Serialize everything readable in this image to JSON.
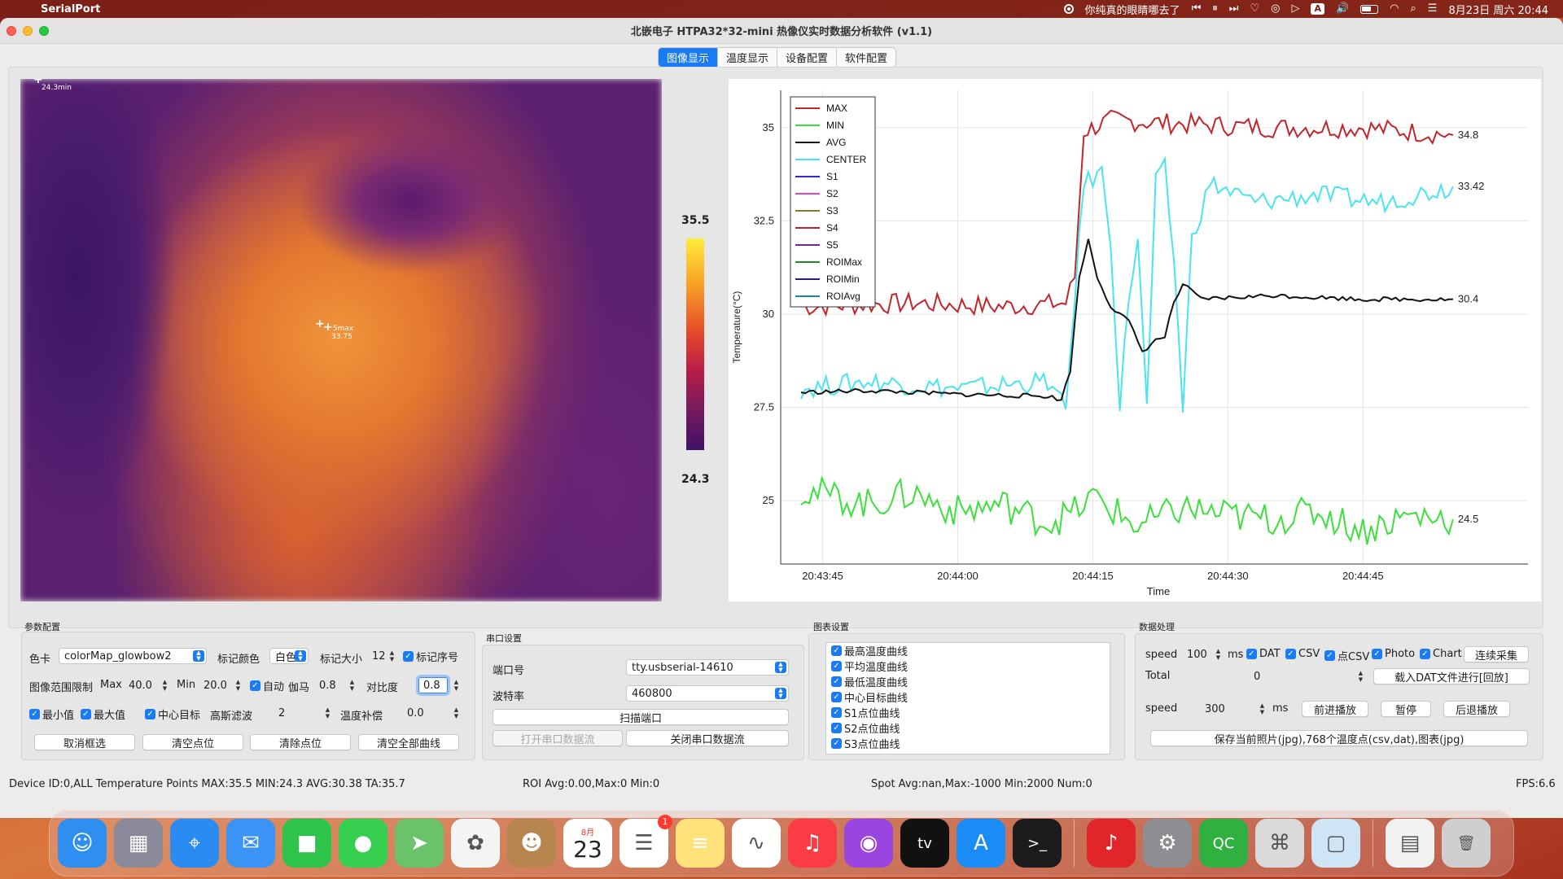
{
  "menubar": {
    "app_name": "SerialPort",
    "now_playing": "你纯真的眼睛哪去了",
    "input_source": "A",
    "datetime": "8月23日 周六  20:44"
  },
  "window": {
    "title": "北嵌电子 HTPA32*32-mini 热像仪实时数据分析软件 (v1.1)"
  },
  "tabs": [
    "图像显示",
    "温度显示",
    "设备配置",
    "软件配置"
  ],
  "active_tab": 0,
  "heatmap": {
    "min_marker": "24.3min",
    "max_marker_label": "5max",
    "max_marker_value": "33.75",
    "colorbar_max": "35.5",
    "colorbar_min": "24.3"
  },
  "chart_data": {
    "type": "line",
    "xlabel": "Time",
    "ylabel": "Temperature(°C)",
    "x_ticks": [
      "20:43:45",
      "20:44:00",
      "20:44:15",
      "20:44:30",
      "20:44:45"
    ],
    "y_ticks": [
      "25",
      "27.5",
      "30",
      "32.5",
      "35"
    ],
    "ylim": [
      23.3,
      36.0
    ],
    "x_range_seconds_from_first_tick": [
      -2.4,
      72
    ],
    "grid": true,
    "legend_position": "top-left",
    "legend": [
      "MAX",
      "MIN",
      "AVG",
      "CENTER",
      "S1",
      "S2",
      "S3",
      "S4",
      "S5",
      "ROIMax",
      "ROIMin",
      "ROIAvg"
    ],
    "legend_colors": [
      "#c0262b",
      "#3be03b",
      "#111111",
      "#4ae3f0",
      "#2b2bd6",
      "#e040e0",
      "#8a7a30",
      "#b0262b",
      "#6a2a8a",
      "#1a8a2a",
      "#1f1f8a",
      "#1a8a9a"
    ],
    "end_labels": [
      "34.8",
      "33.42",
      "30.4",
      "24.5"
    ],
    "series": [
      {
        "name": "MAX",
        "color": "#c0262b",
        "points": [
          [
            -2.4,
            30.2
          ],
          [
            10,
            30.3
          ],
          [
            20,
            30.2
          ],
          [
            27,
            30.3
          ],
          [
            28,
            31.0
          ],
          [
            29,
            34.9
          ],
          [
            32,
            35.2
          ],
          [
            40,
            35.1
          ],
          [
            50,
            35.0
          ],
          [
            60,
            35.0
          ],
          [
            70,
            34.8
          ]
        ]
      },
      {
        "name": "CENTER",
        "color": "#4ae3f0",
        "points": [
          [
            -2.4,
            28.0
          ],
          [
            5,
            28.2
          ],
          [
            15,
            28.0
          ],
          [
            25,
            28.2
          ],
          [
            27,
            27.4
          ],
          [
            28,
            30.5
          ],
          [
            29,
            33.5
          ],
          [
            31,
            33.8
          ],
          [
            32,
            32.0
          ],
          [
            33,
            27.5
          ],
          [
            34,
            30.5
          ],
          [
            35,
            32.0
          ],
          [
            36,
            27.5
          ],
          [
            37,
            33.5
          ],
          [
            38,
            33.9
          ],
          [
            39,
            31.5
          ],
          [
            40,
            27.5
          ],
          [
            41,
            32.0
          ],
          [
            43,
            33.5
          ],
          [
            48,
            33.0
          ],
          [
            55,
            33.2
          ],
          [
            62,
            33.0
          ],
          [
            70,
            33.42
          ]
        ]
      },
      {
        "name": "AVG",
        "color": "#111111",
        "points": [
          [
            -2.4,
            27.9
          ],
          [
            5,
            27.95
          ],
          [
            15,
            27.85
          ],
          [
            25,
            27.8
          ],
          [
            26.5,
            27.7
          ],
          [
            27.5,
            28.5
          ],
          [
            28.5,
            31.0
          ],
          [
            29.5,
            32.0
          ],
          [
            30.5,
            31.0
          ],
          [
            32,
            30.2
          ],
          [
            34,
            29.8
          ],
          [
            35.5,
            29.0
          ],
          [
            37,
            29.3
          ],
          [
            38,
            29.4
          ],
          [
            39,
            30.3
          ],
          [
            40,
            30.8
          ],
          [
            42,
            30.4
          ],
          [
            50,
            30.5
          ],
          [
            60,
            30.4
          ],
          [
            70,
            30.4
          ]
        ]
      },
      {
        "name": "MIN",
        "color": "#3be03b",
        "points": [
          [
            -2.4,
            25.3
          ],
          [
            5,
            24.9
          ],
          [
            10,
            25.2
          ],
          [
            15,
            24.7
          ],
          [
            20,
            24.9
          ],
          [
            25,
            24.4
          ],
          [
            28,
            24.7
          ],
          [
            30,
            25.1
          ],
          [
            35,
            24.3
          ],
          [
            40,
            24.8
          ],
          [
            45,
            24.6
          ],
          [
            50,
            24.5
          ],
          [
            55,
            24.7
          ],
          [
            60,
            24.2
          ],
          [
            65,
            24.6
          ],
          [
            70,
            24.5
          ]
        ]
      }
    ]
  },
  "params": {
    "title": "参数配置",
    "colormap_label": "色卡",
    "colormap_value": "colorMap_glowbow2",
    "mark_color_label": "标记颜色",
    "mark_color_value": "白色",
    "mark_size_label": "标记大小",
    "mark_size_value": "12",
    "mark_index_label": "标记序号",
    "range_label": "图像范围限制",
    "max_label": "Max",
    "max_value": "40.0",
    "min_label": "Min",
    "min_value": "20.0",
    "auto_label": "自动",
    "gamma_label": "伽马",
    "gamma_value": "0.8",
    "contrast_label": "对比度",
    "contrast_value": "0.8",
    "minval_label": "最小值",
    "maxval_label": "最大值",
    "center_label": "中心目标",
    "gauss_label": "高斯滤波",
    "gauss_value": "2",
    "temp_comp_label": "温度补偿",
    "temp_comp_value": "0.0",
    "btn_cancel_select": "取消框选",
    "btn_clear_points": "清空点位",
    "btn_clear_point": "清除点位",
    "btn_clear_curves": "清空全部曲线"
  },
  "serial": {
    "title": "串口设置",
    "port_label": "端口号",
    "port_value": "tty.usbserial-14610",
    "baud_label": "波特率",
    "baud_value": "460800",
    "btn_scan": "扫描端口",
    "btn_open": "打开串口数据流",
    "btn_close": "关闭串口数据流"
  },
  "chart_settings": {
    "title": "图表设置",
    "items": [
      "最高温度曲线",
      "平均温度曲线",
      "最低温度曲线",
      "中心目标曲线",
      "S1点位曲线",
      "S2点位曲线",
      "S3点位曲线"
    ]
  },
  "data_proc": {
    "title": "数据处理",
    "speed_label": "speed",
    "speed_value": "100",
    "ms_label": "ms",
    "dat_label": "DAT",
    "csv_label": "CSV",
    "pcsv_label": "点CSV",
    "photo_label": "Photo",
    "chart_label": "Chart",
    "btn_continuous": "连续采集",
    "total_label": "Total",
    "total_value": "0",
    "btn_load_dat": "载入DAT文件进行[回放]",
    "speed2_label": "speed",
    "speed2_value": "300",
    "ms2_label": "ms",
    "btn_forward": "前进播放",
    "btn_pause": "暂停",
    "btn_backward": "后退播放",
    "btn_save": "保存当前照片(jpg),768个温度点(csv,dat),图表(jpg)"
  },
  "status": {
    "device": "Device ID:0,ALL Temperature Points MAX:35.5 MIN:24.3 AVG:30.38 TA:35.7",
    "roi": "ROI Avg:0.00,Max:0 Min:0",
    "spot": "Spot Avg:nan,Max:-1000 Min:2000 Num:0",
    "fps": "FPS:6.6"
  },
  "dock": {
    "calendar_month": "8月",
    "calendar_day": "23",
    "reminders_badge": "1",
    "apps": [
      {
        "name": "finder-icon",
        "color": "#2f8ff0",
        "glyph": "☺"
      },
      {
        "name": "launchpad-icon",
        "color": "#8a8a9a",
        "glyph": "▦"
      },
      {
        "name": "safari-icon",
        "color": "#2a8cf2",
        "glyph": "⌖"
      },
      {
        "name": "mail-icon",
        "color": "#3a93f5",
        "glyph": "✉"
      },
      {
        "name": "facetime-icon",
        "color": "#2ec44a",
        "glyph": "■"
      },
      {
        "name": "messages-icon",
        "color": "#37cf4f",
        "glyph": "●"
      },
      {
        "name": "maps-icon",
        "color": "#6ac26a",
        "glyph": "➤"
      },
      {
        "name": "photos-icon",
        "color": "#f4f4f4",
        "glyph": "✿"
      },
      {
        "name": "contacts-icon",
        "color": "#b7864e",
        "glyph": "☻"
      },
      {
        "name": "calendar-icon",
        "color": "#ffffff",
        "glyph": ""
      },
      {
        "name": "reminders-icon",
        "color": "#ffffff",
        "glyph": "☰"
      },
      {
        "name": "notes-icon",
        "color": "#ffe27a",
        "glyph": "≡"
      },
      {
        "name": "freeform-icon",
        "color": "#ffffff",
        "glyph": "∿"
      },
      {
        "name": "music-icon",
        "color": "#fc3c44",
        "glyph": "♫"
      },
      {
        "name": "podcasts-icon",
        "color": "#9b45e0",
        "glyph": "◉"
      },
      {
        "name": "appletv-icon",
        "color": "#111111",
        "glyph": "tv"
      },
      {
        "name": "appstore-icon",
        "color": "#1a8cf5",
        "glyph": "A"
      },
      {
        "name": "terminal-icon",
        "color": "#1c1c1c",
        "glyph": ">_"
      },
      {
        "name": "netease-music-icon",
        "color": "#e0262b",
        "glyph": "♪"
      },
      {
        "name": "system-settings-icon",
        "color": "#8d8d92",
        "glyph": "⚙"
      },
      {
        "name": "qc-app-icon",
        "color": "#30b040",
        "glyph": "QC"
      },
      {
        "name": "serial-tool-icon",
        "color": "#dadada",
        "glyph": "⌘"
      },
      {
        "name": "window-app-icon",
        "color": "#cfe4f5",
        "glyph": "▢"
      },
      {
        "name": "recent-screenshot-icon",
        "color": "#f2f2f2",
        "glyph": "▤"
      },
      {
        "name": "trash-icon",
        "color": "#cfcfcf",
        "glyph": "🗑"
      }
    ]
  }
}
